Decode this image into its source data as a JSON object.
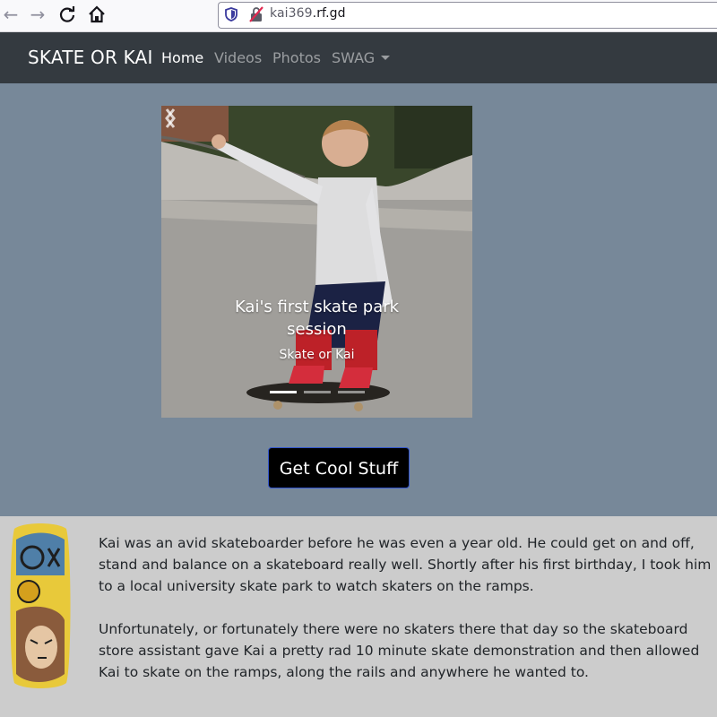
{
  "browser": {
    "url_host": "kai369",
    "url_domain": ".rf.gd"
  },
  "navbar": {
    "brand": "SKATE OR KAI",
    "items": [
      {
        "label": "Home",
        "active": true
      },
      {
        "label": "Videos",
        "active": false
      },
      {
        "label": "Photos",
        "active": false
      },
      {
        "label": "SWAG",
        "active": false,
        "dropdown": true
      }
    ]
  },
  "carousel": {
    "caption_title": "Kai's first skate park session",
    "caption_subtitle": "Skate or Kai",
    "slide_count": 3,
    "active_slide": 1,
    "prev_icon": "chevron-left-icon",
    "next_icon": "chevron-right-icon"
  },
  "cta": {
    "label": "Get Cool Stuff"
  },
  "about": {
    "paragraphs": [
      "Kai was an avid skateboarder before he was even a year old. He could get on and off, stand and balance on a skateboard really well. Shortly after his first birthday, I took him to a local university skate park to watch skaters on the ramps.",
      "Unfortunately, or fortunately there were no skaters there that day so the skateboard store assistant gave Kai a pretty rad 10 minute skate demonstration and then allowed Kai to skate on the ramps, along the rails and anywhere he wanted to."
    ]
  },
  "colors": {
    "navbar_bg": "#343a40",
    "hero_bg": "#778899",
    "page_bg": "#cccccc",
    "cta_bg": "#000000",
    "cta_border": "#3355cc"
  }
}
